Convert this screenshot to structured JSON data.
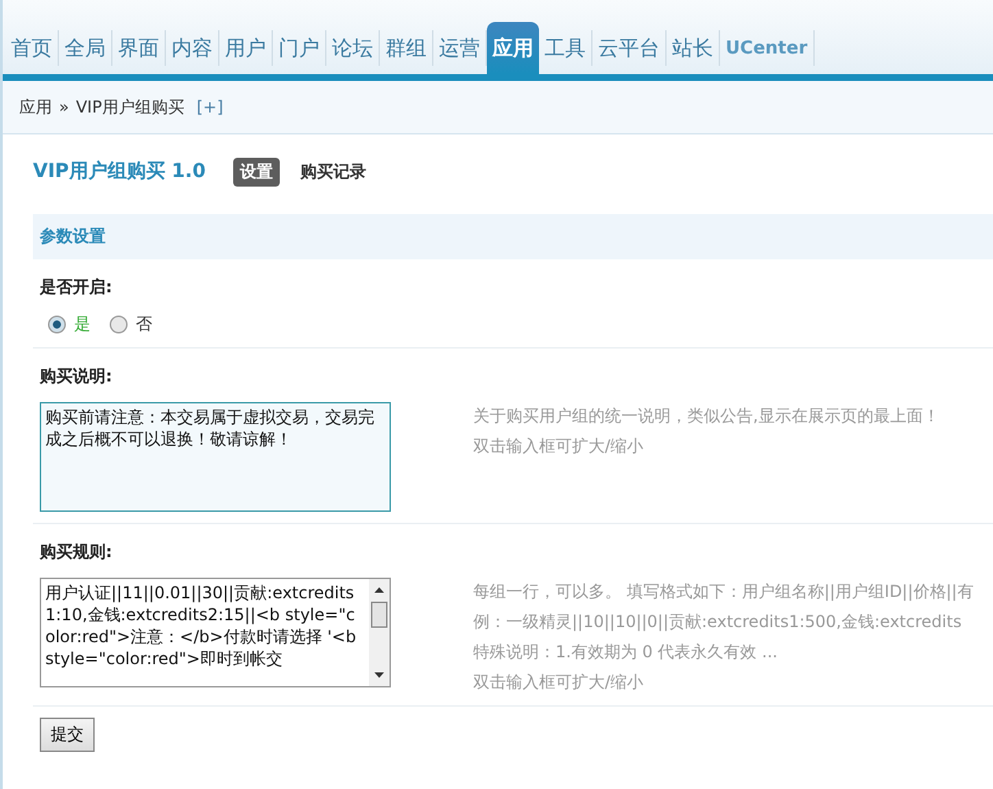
{
  "nav": {
    "tabs": [
      {
        "label": "首页",
        "selected": false
      },
      {
        "label": "全局",
        "selected": false
      },
      {
        "label": "界面",
        "selected": false
      },
      {
        "label": "内容",
        "selected": false
      },
      {
        "label": "用户",
        "selected": false
      },
      {
        "label": "门户",
        "selected": false
      },
      {
        "label": "论坛",
        "selected": false
      },
      {
        "label": "群组",
        "selected": false
      },
      {
        "label": "运营",
        "selected": false
      },
      {
        "label": "应用",
        "selected": true
      },
      {
        "label": "工具",
        "selected": false
      },
      {
        "label": "云平台",
        "selected": false
      },
      {
        "label": "站长",
        "selected": false
      },
      {
        "label": "UCenter",
        "selected": false
      }
    ]
  },
  "breadcrumb": {
    "items": [
      "应用",
      "VIP用户组购买"
    ],
    "separator": "»",
    "add": "[+]"
  },
  "plugin": {
    "title": "VIP用户组购买 1.0",
    "subtabs": [
      {
        "label": "设置",
        "selected": true
      },
      {
        "label": "购买记录",
        "selected": false
      }
    ]
  },
  "section": {
    "title": "参数设置"
  },
  "settings": [
    {
      "kind": "radio",
      "label": "是否开启:",
      "options": [
        {
          "label": "是",
          "selected": true
        },
        {
          "label": "否",
          "selected": false
        }
      ]
    },
    {
      "kind": "textarea",
      "label": "购买说明:",
      "value": "购买前请注意：本交易属于虚拟交易，交易完成之后概不可以退换！敬请谅解！",
      "focused": true,
      "hints": [
        "关于购买用户组的统一说明，类似公告,显示在展示页的最上面！",
        "双击输入框可扩大/缩小"
      ]
    },
    {
      "kind": "textarea",
      "label": "购买规则:",
      "value": "用户认证||11||0.01||30||贡献:extcredits1:10,金钱:extcredits2:15||<b style=\"color:red\">注意：</b>付款时请选择 '<b style=\"color:red\">即时到帐交",
      "focused": false,
      "scrollbar": true,
      "hints": [
        "每组一行，可以多。 填写格式如下：用户组名称||用户组ID||价格||有",
        "例：一级精灵||10||10||0||贡献:extcredits1:500,金钱:extcredits",
        "特殊说明：1.有效期为 0 代表永久有效 ...",
        "双击输入框可扩大/缩小"
      ]
    }
  ],
  "submit": "提交"
}
